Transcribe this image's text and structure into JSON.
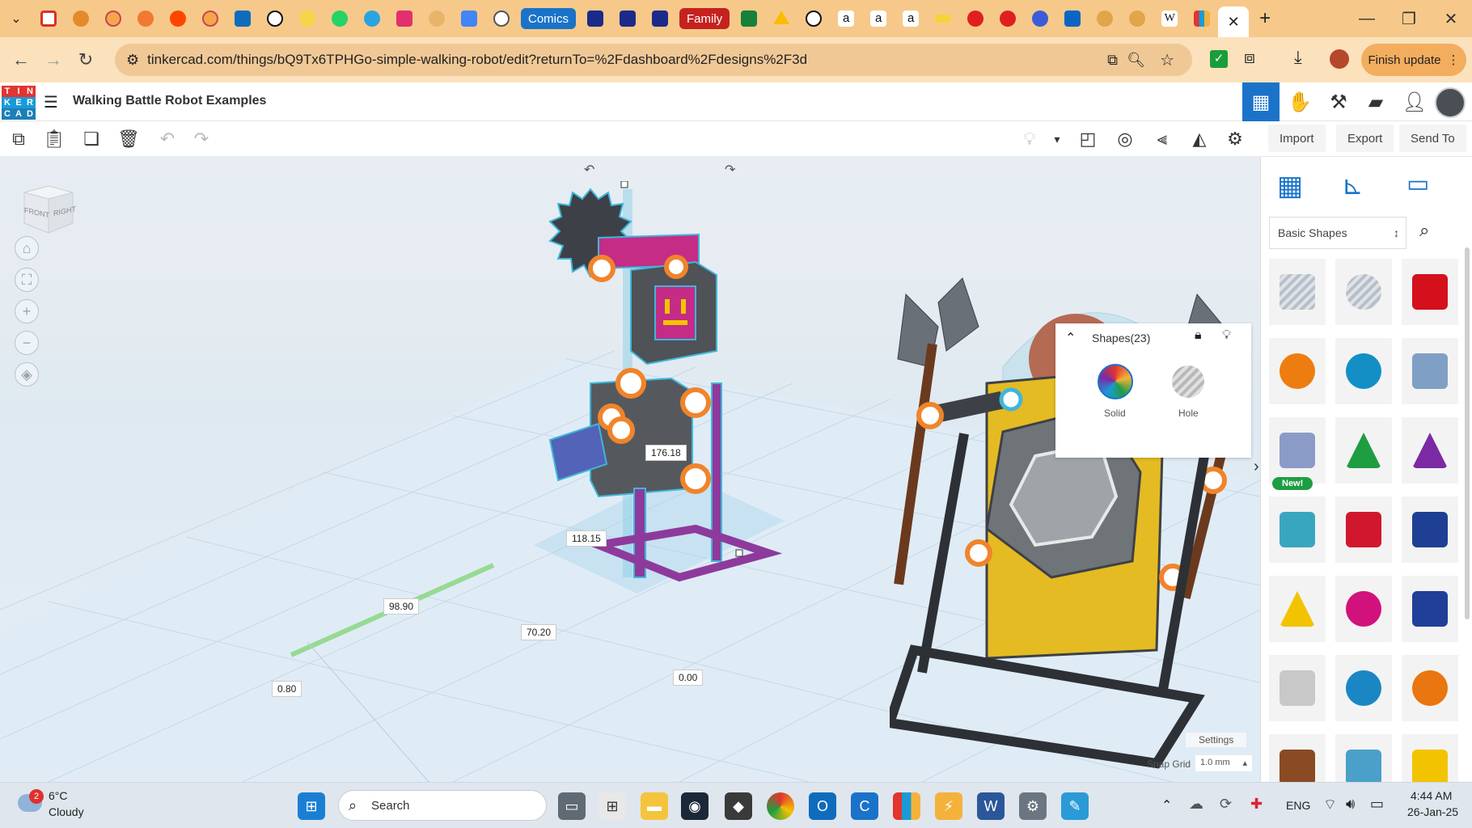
{
  "browser": {
    "tab_labels": {
      "comics": "Comics",
      "family": "Family"
    },
    "address": "tinkercad.com/things/bQ9Tx6TPHGo-simple-walking-robot/edit?returnTo=%2Fdashboard%2Fdesigns%2F3d",
    "finish_update": "Finish update"
  },
  "tinkercad": {
    "logo_letters": [
      "T",
      "I",
      "N",
      "K",
      "E",
      "R",
      "C",
      "A",
      "D"
    ],
    "design_title": "Walking Battle Robot Examples",
    "toolbar": {
      "import": "Import",
      "export": "Export",
      "send_to": "Send To"
    }
  },
  "viewcube": {
    "front": "FRONT",
    "right": "RIGHT"
  },
  "dimensions": {
    "d1": "176.18",
    "d2": "118.15",
    "d3": "98.90",
    "d4": "70.20",
    "d5": "0.80",
    "d6": "0.00"
  },
  "shapes_panel": {
    "title": "Shapes(23)",
    "solid": "Solid",
    "hole": "Hole"
  },
  "library": {
    "category": "Basic Shapes",
    "new_badge": "New!",
    "shapes": [
      {
        "name": "box-striped",
        "color": "#b6bfca"
      },
      {
        "name": "cylinder-striped",
        "color": "#b6bfca"
      },
      {
        "name": "box",
        "color": "#d4101c"
      },
      {
        "name": "cylinder",
        "color": "#ee7d11"
      },
      {
        "name": "sphere",
        "color": "#138fc6"
      },
      {
        "name": "scribble",
        "color": "#7fa0c4"
      },
      {
        "name": "pen",
        "color": "#8b9bc8"
      },
      {
        "name": "roof",
        "color": "#1f9d43"
      },
      {
        "name": "cone",
        "color": "#7b2aa3"
      },
      {
        "name": "round-roof",
        "color": "#39a6c0"
      },
      {
        "name": "text",
        "color": "#d1172d"
      },
      {
        "name": "box-dark",
        "color": "#1e3f93"
      },
      {
        "name": "pyramid",
        "color": "#f2c300"
      },
      {
        "name": "half-sphere",
        "color": "#d1127c"
      },
      {
        "name": "polygon",
        "color": "#203f99"
      },
      {
        "name": "paraboloid",
        "color": "#c8c8c8"
      },
      {
        "name": "torus",
        "color": "#1a87c4"
      },
      {
        "name": "tube",
        "color": "#e9760f"
      },
      {
        "name": "heart",
        "color": "#8a4a23"
      },
      {
        "name": "star",
        "color": "#4aa0c8"
      },
      {
        "name": "star-yellow",
        "color": "#f2c300"
      }
    ]
  },
  "settings": {
    "label": "Settings",
    "snap_grid": "Snap Grid",
    "snap_value": "1.0 mm"
  },
  "taskbar": {
    "weather_badge": "2",
    "temp": "6°C",
    "condition": "Cloudy",
    "search_placeholder": "Search",
    "lang": "ENG",
    "time": "4:44 AM",
    "date": "26-Jan-25"
  },
  "colors": {
    "accent": "#1a73c9",
    "tab_strip": "#f6c98a",
    "selection": "#3fb6d9"
  }
}
